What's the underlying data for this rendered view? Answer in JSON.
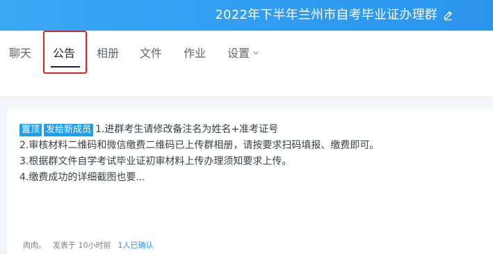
{
  "header": {
    "group_title": "2022年下半年兰州市自考毕业证办理群",
    "edit_icon": "pencil-icon"
  },
  "tabs": [
    {
      "label": "聊天"
    },
    {
      "label": "公告"
    },
    {
      "label": "相册"
    },
    {
      "label": "文件"
    },
    {
      "label": "作业"
    },
    {
      "label": "设置"
    }
  ],
  "active_tab": "公告",
  "notice": {
    "badges": [
      "置顶",
      "发给新成员"
    ],
    "lines": [
      "1.进群考生请修改备注名为姓名+准考证号",
      "2.审核材料二维码和微信缴费二维码已上传群相册，请按要求扫码填报、缴费即可。",
      "3.根据群文件自学考试毕业证初审材料上传办理须知要求上传。",
      "4.缴费成功的详细截图也要..."
    ],
    "author": "肉肉。",
    "posted": "发表于 10小时前",
    "confirmed": "1人已确认"
  },
  "colors": {
    "titlebar": "#2f9cf0",
    "badge": "#1ea0f0",
    "highlight": "#e0201e",
    "link": "#2a8de6"
  }
}
